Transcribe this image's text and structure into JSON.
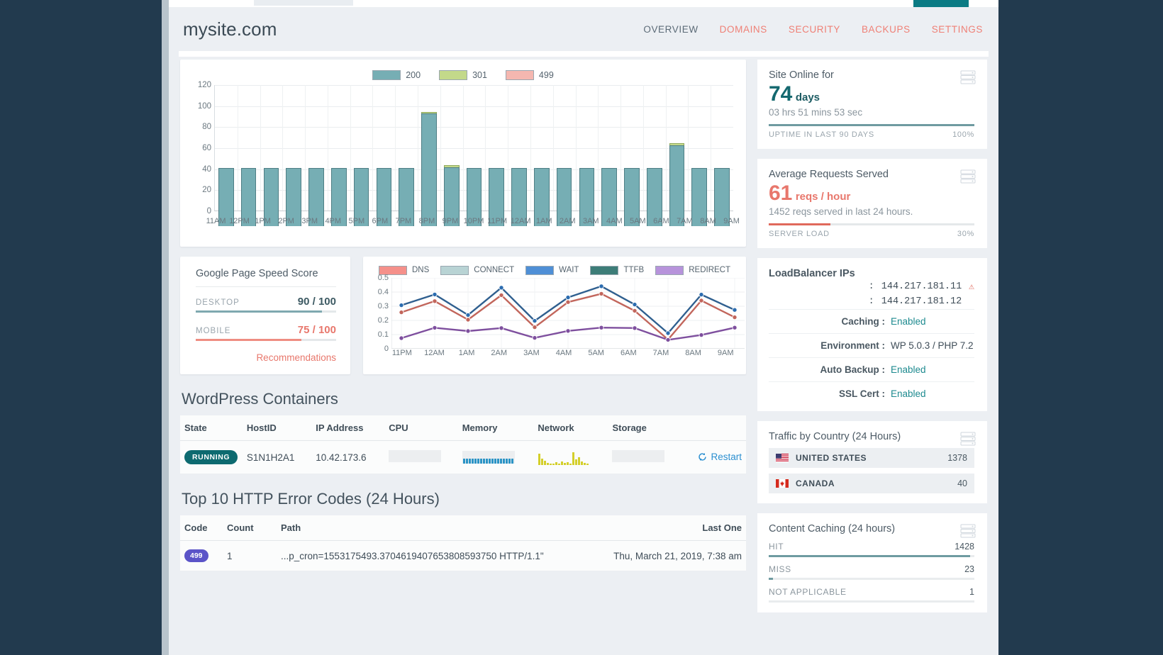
{
  "header": {
    "site_title": "mysite.com",
    "nav": [
      {
        "label": "OVERVIEW",
        "active": true
      },
      {
        "label": "DOMAINS",
        "active": false
      },
      {
        "label": "SECURITY",
        "active": false
      },
      {
        "label": "BACKUPS",
        "active": false
      },
      {
        "label": "SETTINGS",
        "active": false
      }
    ]
  },
  "chart_data": [
    {
      "type": "bar",
      "title": "",
      "xlabel": "",
      "ylabel": "",
      "ylim": [
        0,
        120
      ],
      "yticks": [
        0,
        20,
        40,
        60,
        80,
        100,
        120
      ],
      "grid": true,
      "legend_position": "top-center",
      "stacked": true,
      "categories": [
        "11AM",
        "12PM",
        "1PM",
        "2PM",
        "3PM",
        "4PM",
        "5PM",
        "6PM",
        "7PM",
        "8PM",
        "9PM",
        "10PM",
        "11PM",
        "12AM",
        "1AM",
        "2AM",
        "3AM",
        "4AM",
        "5AM",
        "6AM",
        "7AM",
        "8AM",
        "9AM"
      ],
      "series": [
        {
          "name": "200",
          "color": "#76aeb4",
          "values": [
            55,
            55,
            55,
            55,
            55,
            55,
            55,
            55,
            55,
            107,
            56,
            55,
            55,
            55,
            55,
            55,
            55,
            55,
            55,
            55,
            77,
            55,
            55
          ]
        },
        {
          "name": "301",
          "color": "#c3d98a",
          "values": [
            0,
            0,
            0,
            0,
            0,
            0,
            0,
            0,
            0,
            1,
            2,
            0,
            0,
            0,
            0,
            0,
            0,
            0,
            0,
            0,
            2,
            0,
            0
          ]
        },
        {
          "name": "499",
          "color": "#f5b7b0",
          "values": [
            0,
            0,
            0,
            0,
            0,
            0,
            0,
            0,
            0,
            0,
            0,
            0,
            0,
            0,
            0,
            0,
            0,
            0,
            0,
            0,
            0,
            0,
            0
          ]
        }
      ]
    },
    {
      "type": "line",
      "title": "",
      "xlabel": "",
      "ylabel": "",
      "ylim": [
        0,
        0.5
      ],
      "yticks": [
        0,
        0.1,
        0.2,
        0.3,
        0.4,
        0.5
      ],
      "grid": true,
      "legend_position": "top-center",
      "x": [
        "11PM",
        "12AM",
        "1AM",
        "2AM",
        "3AM",
        "4AM",
        "5AM",
        "6AM",
        "7AM",
        "8AM",
        "9AM"
      ],
      "series": [
        {
          "name": "DNS",
          "color": "#f5908a",
          "values": [
            0.075,
            0.148,
            0.125,
            0.146,
            0.077,
            0.126,
            0.149,
            0.146,
            0.063,
            0.097,
            0.149
          ]
        },
        {
          "name": "CONNECT",
          "color": "#b8d3d4",
          "values": [
            0.075,
            0.148,
            0.125,
            0.146,
            0.077,
            0.126,
            0.149,
            0.146,
            0.063,
            0.097,
            0.149
          ]
        },
        {
          "name": "WAIT",
          "color": "#4f8fd6",
          "values": [
            0.307,
            0.383,
            0.238,
            0.431,
            0.197,
            0.362,
            0.441,
            0.312,
            0.11,
            0.382,
            0.274
          ]
        },
        {
          "name": "TTFB",
          "color": "#3d7d78",
          "values": [
            0.257,
            0.336,
            0.205,
            0.378,
            0.152,
            0.329,
            0.388,
            0.268,
            0.065,
            0.34,
            0.222
          ]
        },
        {
          "name": "REDIRECT",
          "color": "#b793db",
          "values": [
            0.075,
            0.148,
            0.125,
            0.146,
            0.077,
            0.126,
            0.149,
            0.146,
            0.063,
            0.097,
            0.149
          ]
        }
      ],
      "drawn_lines": [
        {
          "name": "WAIT",
          "stroke": "#2f5f8f",
          "point_fill": "#2b6cb0",
          "values": [
            0.307,
            0.383,
            0.238,
            0.431,
            0.197,
            0.362,
            0.441,
            0.312,
            0.11,
            0.382,
            0.274
          ]
        },
        {
          "name": "TTFB",
          "stroke": "#c2665c",
          "point_fill": "#c2665c",
          "values": [
            0.257,
            0.336,
            0.205,
            0.378,
            0.152,
            0.329,
            0.388,
            0.268,
            0.065,
            0.34,
            0.222
          ]
        },
        {
          "name": "REDIRECT",
          "stroke": "#7e4f9e",
          "point_fill": "#7e4f9e",
          "values": [
            0.075,
            0.148,
            0.125,
            0.146,
            0.077,
            0.126,
            0.149,
            0.146,
            0.063,
            0.097,
            0.149
          ]
        }
      ]
    }
  ],
  "page_speed": {
    "title": "Google Page Speed Score",
    "desktop_label": "DESKTOP",
    "desktop_score": "90 / 100",
    "desktop_pct": 90,
    "mobile_label": "MOBILE",
    "mobile_score": "75 / 100",
    "mobile_pct": 75,
    "recommendations_label": "Recommendations"
  },
  "containers": {
    "title": "WordPress Containers",
    "columns": [
      "State",
      "HostID",
      "IP Address",
      "CPU",
      "Memory",
      "Network",
      "Storage",
      ""
    ],
    "rows": [
      {
        "state": "RUNNING",
        "host_id": "S1N1H2A1",
        "ip_address": "10.42.173.6",
        "cpu": "",
        "memory": "",
        "network": "",
        "storage": "",
        "action": "Restart"
      }
    ]
  },
  "errors": {
    "title": "Top 10 HTTP Error Codes (24 Hours)",
    "columns": [
      "Code",
      "Count",
      "Path",
      "Last One"
    ],
    "rows": [
      {
        "code": "499",
        "count": "1",
        "path": "...p_cron=1553175493.3704619407653808593750 HTTP/1.1\"",
        "last_one": "Thu, March 21, 2019, 7:38 am"
      }
    ]
  },
  "sidebar": {
    "uptime": {
      "title": "Site Online for",
      "value": "74",
      "unit": "days",
      "detail": "03 hrs 51 mins 53 sec",
      "bar_pct": 100,
      "foot_label": "UPTIME IN LAST 90 DAYS",
      "foot_value": "100%",
      "icon": "server-stack-icon"
    },
    "requests": {
      "title": "Average Requests Served",
      "value": "61",
      "unit": "reqs / hour",
      "detail": "1452 reqs served in last 24 hours.",
      "bar_pct": 30,
      "foot_label": "SERVER LOAD",
      "foot_value": "30%",
      "icon": "server-stack-icon"
    },
    "loadbalancer": {
      "title": "LoadBalancer IPs",
      "ips": [
        {
          "value": "144.217.181.11",
          "warning": true
        },
        {
          "value": "144.217.181.12",
          "warning": false
        }
      ],
      "rows": [
        {
          "key": "Caching :",
          "value": "Enabled",
          "accent": true
        },
        {
          "key": "Environment :",
          "value": "WP 5.0.3 / PHP 7.2",
          "accent": false
        },
        {
          "key": "Auto Backup :",
          "value": "Enabled",
          "accent": true
        },
        {
          "key": "SSL Cert :",
          "value": "Enabled",
          "accent": true
        }
      ]
    },
    "traffic": {
      "title": "Traffic by Country (24 Hours)",
      "icon": "server-stack-icon",
      "rows": [
        {
          "flag": "us-flag-icon",
          "name": "UNITED STATES",
          "count": "1378"
        },
        {
          "flag": "ca-flag-icon",
          "name": "CANADA",
          "count": "40"
        }
      ]
    },
    "caching": {
      "title": "Content Caching (24 hours)",
      "icon": "server-stack-icon",
      "rows": [
        {
          "name": "HIT",
          "value": "1428",
          "pct": 98
        },
        {
          "name": "MISS",
          "value": "23",
          "pct": 2
        },
        {
          "name": "NOT APPLICABLE",
          "value": "1",
          "pct": 0
        }
      ]
    }
  },
  "colors": {
    "accent_red": "#e8776c",
    "accent_teal": "#14686f",
    "bar_200": "#76aeb4",
    "bar_301": "#c3d98a",
    "bar_499": "#f5b7b0"
  }
}
